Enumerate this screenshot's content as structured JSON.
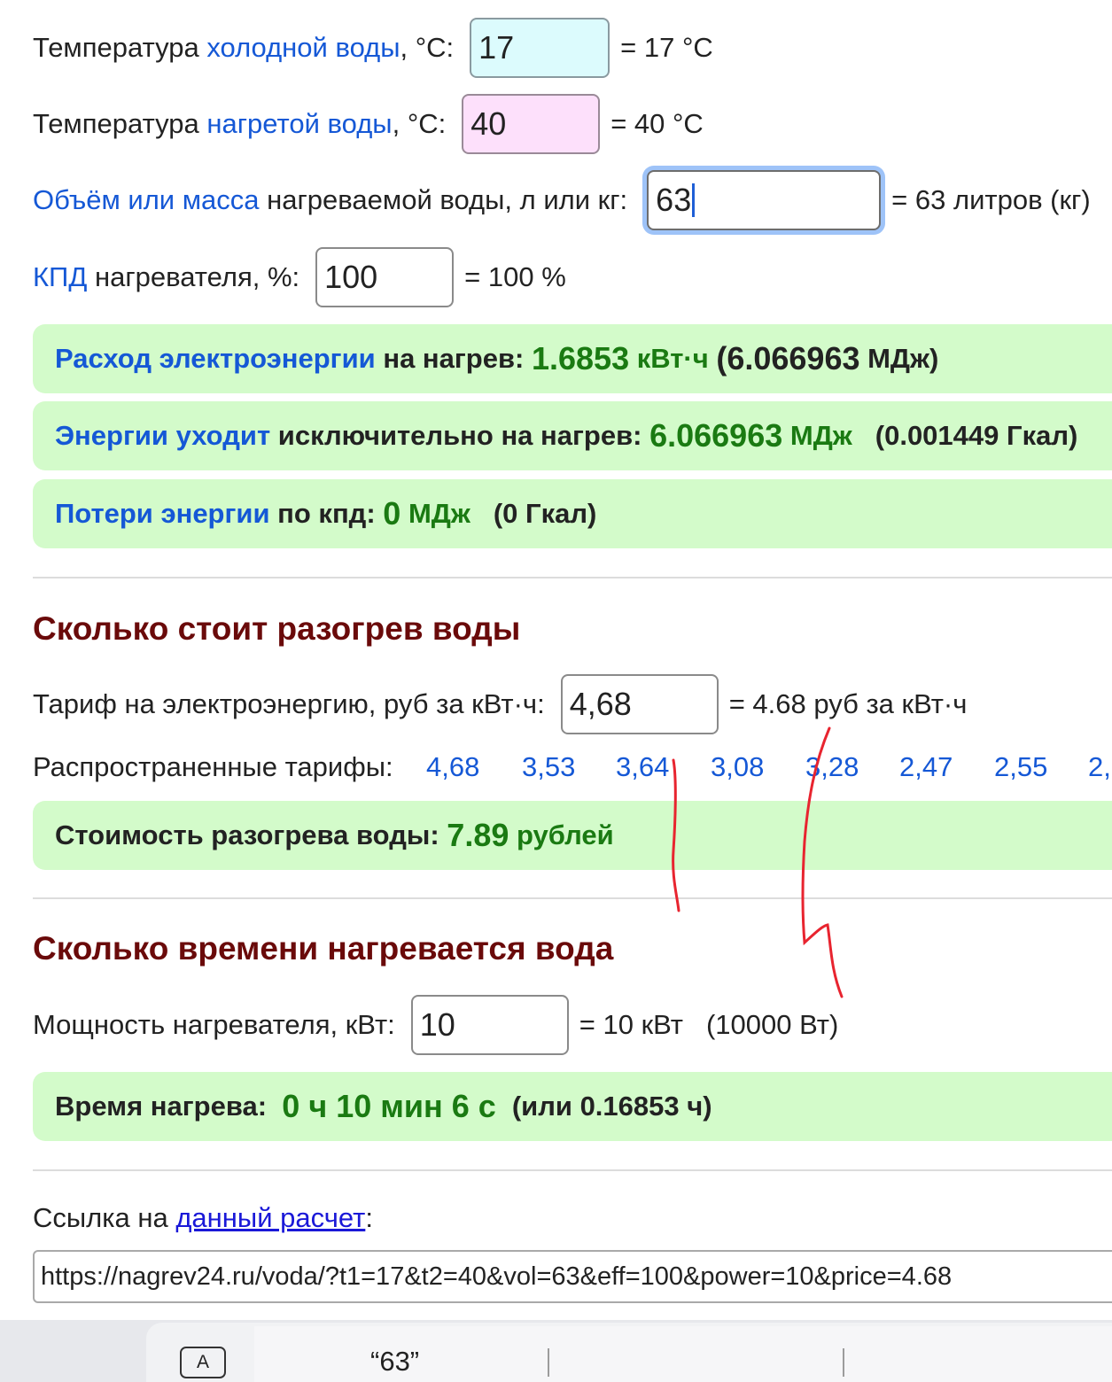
{
  "inputs": {
    "cold": {
      "label_pre": "Температура",
      "label_link": "холодной воды",
      "label_post": ", °C:",
      "value": "17",
      "result": "= 17 °C"
    },
    "hot": {
      "label_pre": "Температура",
      "label_link": "нагретой воды",
      "label_post": ", °C:",
      "value": "40",
      "result": "= 40 °C"
    },
    "volume": {
      "label_link": "Объём или масса",
      "label_post": "нагреваемой воды, л или кг:",
      "value": "63",
      "result": "= 63 литров (кг)"
    },
    "efficiency": {
      "label_link": "КПД",
      "label_post": "нагревателя, %:",
      "value": "100",
      "result": "= 100 %"
    }
  },
  "results": {
    "consumption": {
      "label_link": "Расход электроэнергии",
      "label_post": "на нагрев:",
      "value": "1.6853",
      "unit": "кВт·ч",
      "extra_value": "(6.066963",
      "extra_unit": "МДж)"
    },
    "heating_energy": {
      "label_link": "Энергии уходит",
      "label_post": "исключительно на нагрев:",
      "value": "6.066963",
      "unit": "МДж",
      "extra": "(0.001449 Гкал)"
    },
    "losses": {
      "label_link": "Потери энергии",
      "label_post": "по кпд:",
      "value": "0",
      "unit": "МДж",
      "extra": "(0 Гкал)"
    }
  },
  "cost": {
    "heading": "Сколько стоит разогрев воды",
    "tariff_label": "Тариф на электроэнергию, руб за кВт·ч:",
    "tariff_value": "4,68",
    "tariff_result": "= 4.68 руб за кВт·ч",
    "common_label": "Распространенные тарифы:",
    "common_tariffs": [
      "4,68",
      "3,53",
      "3,64",
      "3,08",
      "3,28",
      "2,47",
      "2,55",
      "2,"
    ],
    "result_label": "Стоимость разогрева воды:",
    "result_value": "7.89",
    "result_unit": "рублей"
  },
  "time": {
    "heading": "Сколько времени нагревается вода",
    "power_label": "Мощность нагревателя, кВт:",
    "power_value": "10",
    "power_result": "= 10 кВт",
    "power_result_w": "(10000 Вт)",
    "result_label": "Время нагрева:",
    "result_value": "0 ч 10 мин 6 с",
    "result_extra": "(или 0.16853 ч)"
  },
  "share": {
    "label_pre": "Ссылка на",
    "label_link": "данный расчет",
    "label_post": ":",
    "url": "https://nagrev24.ru/voda/?t1=17&t2=40&vol=63&eff=100&power=10&price=4.68"
  },
  "keyboard": {
    "key_label": "A",
    "suggestion": "“63”"
  },
  "colors": {
    "link": "#1558d6",
    "result_bg": "#d3fbca",
    "result_value": "#1a7a12",
    "heading": "#6a0a0a",
    "cold_bg": "#dcfbfd",
    "hot_bg": "#fde0fb",
    "annotation": "#e8242f"
  }
}
